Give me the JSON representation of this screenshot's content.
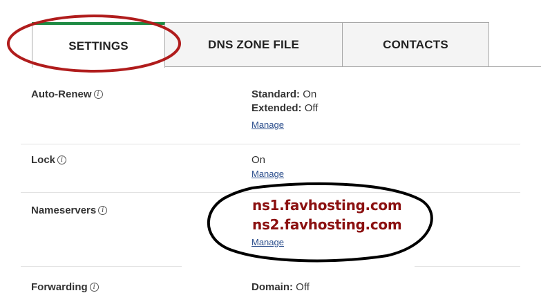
{
  "tabs": [
    {
      "label": "SETTINGS",
      "active": true
    },
    {
      "label": "DNS ZONE FILE",
      "active": false
    },
    {
      "label": "CONTACTS",
      "active": false
    }
  ],
  "rows": {
    "auto_renew": {
      "label": "Auto-Renew",
      "standard_key": "Standard:",
      "standard_value": "On",
      "extended_key": "Extended:",
      "extended_value": "Off",
      "manage": "Manage"
    },
    "lock": {
      "label": "Lock",
      "value": "On",
      "manage": "Manage"
    },
    "nameservers": {
      "label": "Nameservers",
      "ns1": "ns1.favhosting.com",
      "ns2": "ns2.favhosting.com",
      "manage": "Manage"
    },
    "forwarding": {
      "label": "Forwarding",
      "domain_key": "Domain:",
      "domain_value": "Off"
    }
  },
  "info_icon_glyph": "i",
  "colors": {
    "active_tab_accent": "#1e8a43",
    "nameserver_text": "#8b1010",
    "link": "#2a4d8c",
    "red_annotation": "#b01c1c",
    "black_annotation": "#000000"
  }
}
